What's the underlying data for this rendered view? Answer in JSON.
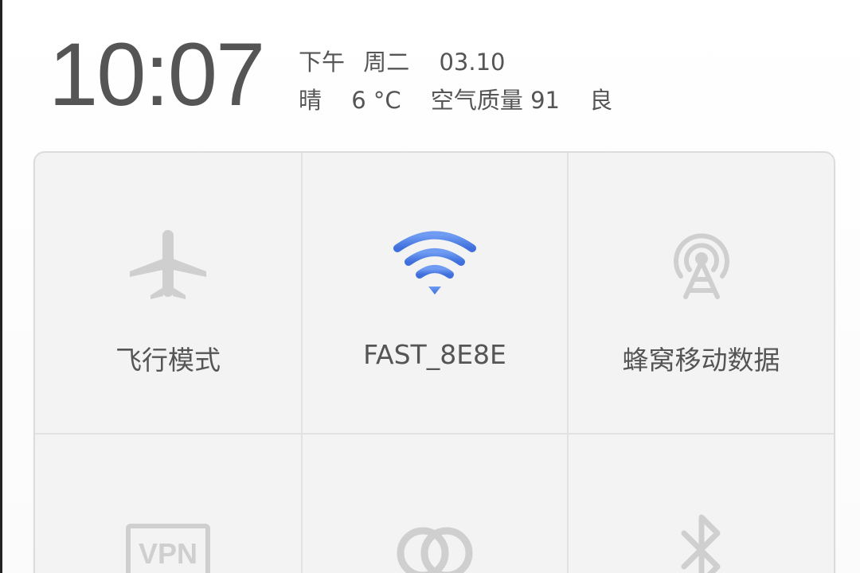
{
  "status": {
    "time": "10:07",
    "period": "下午",
    "weekday": "周二",
    "date": "03.10",
    "weather": "晴",
    "temperature": "6 °C",
    "air_quality_label": "空气质量 91",
    "air_quality_level": "良"
  },
  "toggles": [
    {
      "label": "飞行模式",
      "icon": "airplane-icon",
      "active": false
    },
    {
      "label": "FAST_8E8E",
      "icon": "wifi-icon",
      "active": true
    },
    {
      "label": "蜂窝移动数据",
      "icon": "cellular-antenna-icon",
      "active": false
    },
    {
      "label": "",
      "icon": "vpn-icon",
      "icon_text": "VPN",
      "active": false
    },
    {
      "label": "",
      "icon": "linked-rings-icon",
      "active": false
    },
    {
      "label": "",
      "icon": "bluetooth-icon",
      "active": false
    }
  ],
  "colors": {
    "active_icon": "#4a7fe8",
    "inactive_icon": "#cfcfcf",
    "text": "#555555"
  }
}
